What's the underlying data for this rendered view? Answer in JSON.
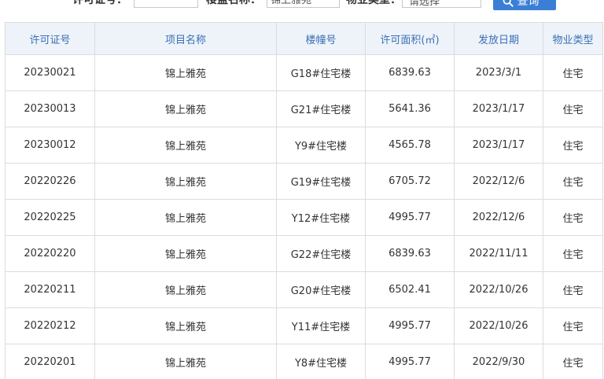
{
  "search": {
    "permit_label": "许可证号：",
    "permit_value": "",
    "building_label": "楼盘名称：",
    "building_value": "锦上雅苑",
    "property_label": "物业类型：",
    "property_value": "请选择",
    "button_label": "查询"
  },
  "table": {
    "headers": [
      "许可证号",
      "项目名称",
      "楼幢号",
      "许可面积(㎡)",
      "发放日期",
      "物业类型"
    ],
    "rows": [
      [
        "20230021",
        "锦上雅苑",
        "G18#住宅楼",
        "6839.63",
        "2023/3/1",
        "住宅"
      ],
      [
        "20230013",
        "锦上雅苑",
        "G21#住宅楼",
        "5641.36",
        "2023/1/17",
        "住宅"
      ],
      [
        "20230012",
        "锦上雅苑",
        "Y9#住宅楼",
        "4565.78",
        "2023/1/17",
        "住宅"
      ],
      [
        "20220226",
        "锦上雅苑",
        "G19#住宅楼",
        "6705.72",
        "2022/12/6",
        "住宅"
      ],
      [
        "20220225",
        "锦上雅苑",
        "Y12#住宅楼",
        "4995.77",
        "2022/12/6",
        "住宅"
      ],
      [
        "20220220",
        "锦上雅苑",
        "G22#住宅楼",
        "6839.63",
        "2022/11/11",
        "住宅"
      ],
      [
        "20220211",
        "锦上雅苑",
        "G20#住宅楼",
        "6502.41",
        "2022/10/26",
        "住宅"
      ],
      [
        "20220212",
        "锦上雅苑",
        "Y11#住宅楼",
        "4995.77",
        "2022/10/26",
        "住宅"
      ],
      [
        "20220201",
        "锦上雅苑",
        "Y8#住宅楼",
        "4995.77",
        "2022/9/30",
        "住宅"
      ]
    ]
  },
  "colors": {
    "header_bg": "#eef3fa",
    "header_text": "#3a6fb5",
    "button_bg": "#3a7fd5",
    "border": "#dcdcdc"
  }
}
